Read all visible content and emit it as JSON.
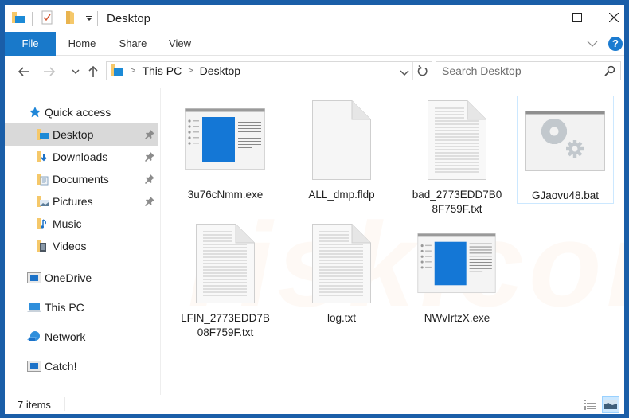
{
  "window": {
    "title": "Desktop",
    "controls": {
      "minimize": "minimize",
      "maximize": "maximize",
      "close": "close"
    }
  },
  "quick_access_toolbar": {
    "icons": [
      "folder-desktop-icon",
      "properties-icon",
      "new-folder-icon",
      "customize-dropdown-icon"
    ]
  },
  "ribbon": {
    "tabs": [
      {
        "label": "File",
        "active": true
      },
      {
        "label": "Home"
      },
      {
        "label": "Share"
      },
      {
        "label": "View"
      }
    ],
    "help_label": "?"
  },
  "navigation": {
    "address": {
      "crumbs": [
        "This PC",
        "Desktop"
      ]
    },
    "search_placeholder": "Search Desktop"
  },
  "sidebar": {
    "quick_access_label": "Quick access",
    "items": [
      {
        "label": "Desktop",
        "icon": "desktop-folder-icon",
        "pinned": true,
        "selected": true
      },
      {
        "label": "Downloads",
        "icon": "downloads-folder-icon",
        "pinned": true
      },
      {
        "label": "Documents",
        "icon": "documents-folder-icon",
        "pinned": true
      },
      {
        "label": "Pictures",
        "icon": "pictures-folder-icon",
        "pinned": true
      },
      {
        "label": "Music",
        "icon": "music-folder-icon",
        "pinned": false
      },
      {
        "label": "Videos",
        "icon": "videos-folder-icon",
        "pinned": false
      }
    ],
    "locations": [
      {
        "label": "OneDrive",
        "icon": "onedrive-icon"
      },
      {
        "label": "This PC",
        "icon": "this-pc-icon"
      },
      {
        "label": "Network",
        "icon": "network-icon"
      },
      {
        "label": "Catch!",
        "icon": "catch-icon"
      }
    ]
  },
  "files": [
    {
      "name": "3u76cNmm.exe",
      "type": "exe"
    },
    {
      "name": "ALL_dmp.fldp",
      "type": "blank"
    },
    {
      "name": "bad_2773EDD7B08F759F.txt",
      "type": "txt"
    },
    {
      "name": "GJaovu48.bat",
      "type": "bat",
      "selected": true
    },
    {
      "name": "LFIN_2773EDD7B08F759F.txt",
      "type": "txt"
    },
    {
      "name": "log.txt",
      "type": "txt"
    },
    {
      "name": "NWvIrtzX.exe",
      "type": "exe"
    }
  ],
  "status": {
    "item_count": "7 items"
  },
  "watermark": "PC risk.com"
}
